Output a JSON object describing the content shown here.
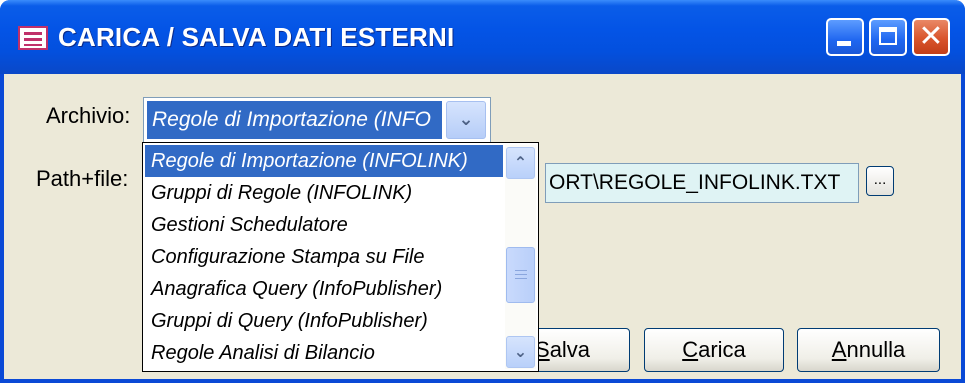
{
  "window": {
    "title": "CARICA / SALVA DATI ESTERNI",
    "icon": "table-icon"
  },
  "form": {
    "archivio_label": "Archivio:",
    "archivio_value": "Regole di Importazione (INFO",
    "path_label": "Path+file:",
    "path_value": "ORT\\REGOLE_INFOLINK.TXT",
    "browse_label": "..."
  },
  "dropdown": {
    "selected_index": 0,
    "options": [
      "Regole di Importazione (INFOLINK)",
      "Gruppi di Regole (INFOLINK)",
      "Gestioni Schedulatore",
      "Configurazione Stampa su File",
      "Anagrafica Query (InfoPublisher)",
      "Gruppi di Query (InfoPublisher)",
      "Regole Analisi di Bilancio"
    ]
  },
  "buttons": {
    "salva_first": "S",
    "salva_rest": "alva",
    "carica_first": "C",
    "carica_rest": "arica",
    "annulla_first": "A",
    "annulla_rest": "nnulla"
  },
  "colors": {
    "titlebar": "#0454e6",
    "selection": "#316ac5",
    "window_bg": "#ece9d8",
    "path_field_bg": "#dff3f4"
  }
}
